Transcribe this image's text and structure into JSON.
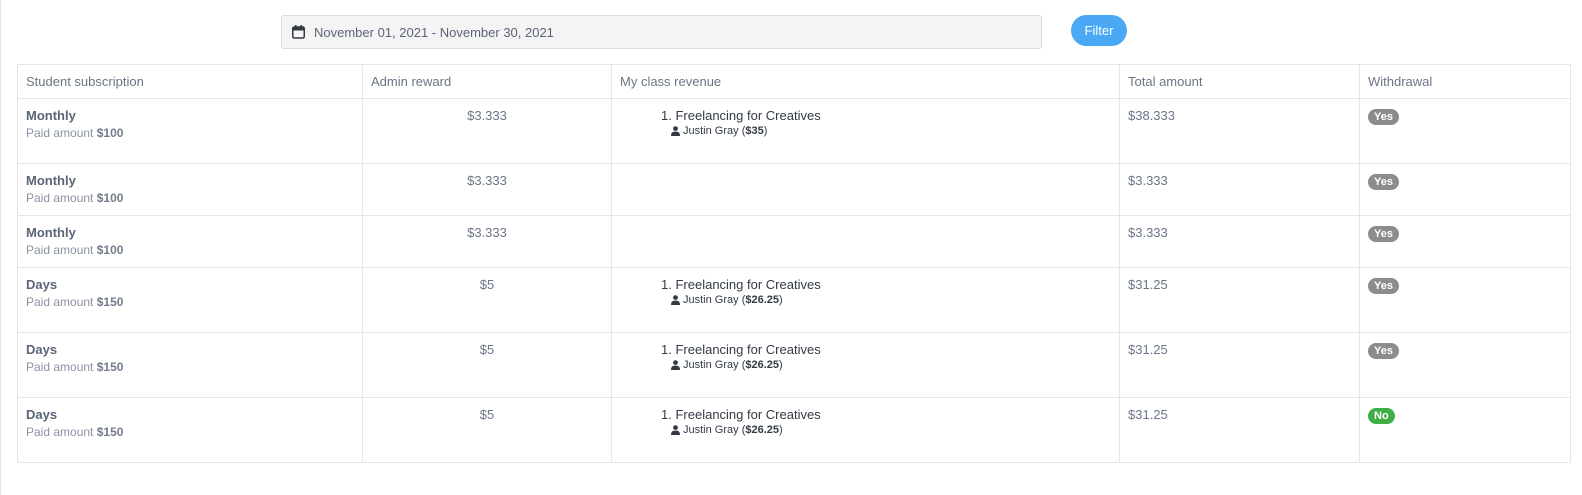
{
  "filter": {
    "date_range": "November 01, 2021 - November 30, 2021",
    "button_label": "Filter"
  },
  "table": {
    "headers": [
      "Student subscription",
      "Admin reward",
      "My class revenue",
      "Total amount",
      "Withdrawal"
    ],
    "rows": [
      {
        "plan": "Monthly",
        "paid_label": "Paid amount",
        "paid_value": "$100",
        "admin_reward": "$3.333",
        "revenue_index": "1.",
        "revenue_class": "Freelancing for Creatives",
        "revenue_teacher": "Justin Gray",
        "revenue_amount": "$35",
        "total": "$38.333",
        "withdrawal": "Yes"
      },
      {
        "plan": "Monthly",
        "paid_label": "Paid amount",
        "paid_value": "$100",
        "admin_reward": "$3.333",
        "total": "$3.333",
        "withdrawal": "Yes"
      },
      {
        "plan": "Monthly",
        "paid_label": "Paid amount",
        "paid_value": "$100",
        "admin_reward": "$3.333",
        "total": "$3.333",
        "withdrawal": "Yes"
      },
      {
        "plan": "Days",
        "paid_label": "Paid amount",
        "paid_value": "$150",
        "admin_reward": "$5",
        "revenue_index": "1.",
        "revenue_class": "Freelancing for Creatives",
        "revenue_teacher": "Justin Gray",
        "revenue_amount": "$26.25",
        "total": "$31.25",
        "withdrawal": "Yes"
      },
      {
        "plan": "Days",
        "paid_label": "Paid amount",
        "paid_value": "$150",
        "admin_reward": "$5",
        "revenue_index": "1.",
        "revenue_class": "Freelancing for Creatives",
        "revenue_teacher": "Justin Gray",
        "revenue_amount": "$26.25",
        "total": "$31.25",
        "withdrawal": "Yes"
      },
      {
        "plan": "Days",
        "paid_label": "Paid amount",
        "paid_value": "$150",
        "admin_reward": "$5",
        "revenue_index": "1.",
        "revenue_class": "Freelancing for Creatives",
        "revenue_teacher": "Justin Gray",
        "revenue_amount": "$26.25",
        "total": "$31.25",
        "withdrawal": "No"
      }
    ]
  },
  "colors": {
    "filter_button": "#4aa8f5",
    "badge_yes": "#8c8c8c",
    "badge_no": "#3fae46"
  },
  "icons": {
    "date_range": "calendar-icon",
    "teacher": "user-icon"
  }
}
